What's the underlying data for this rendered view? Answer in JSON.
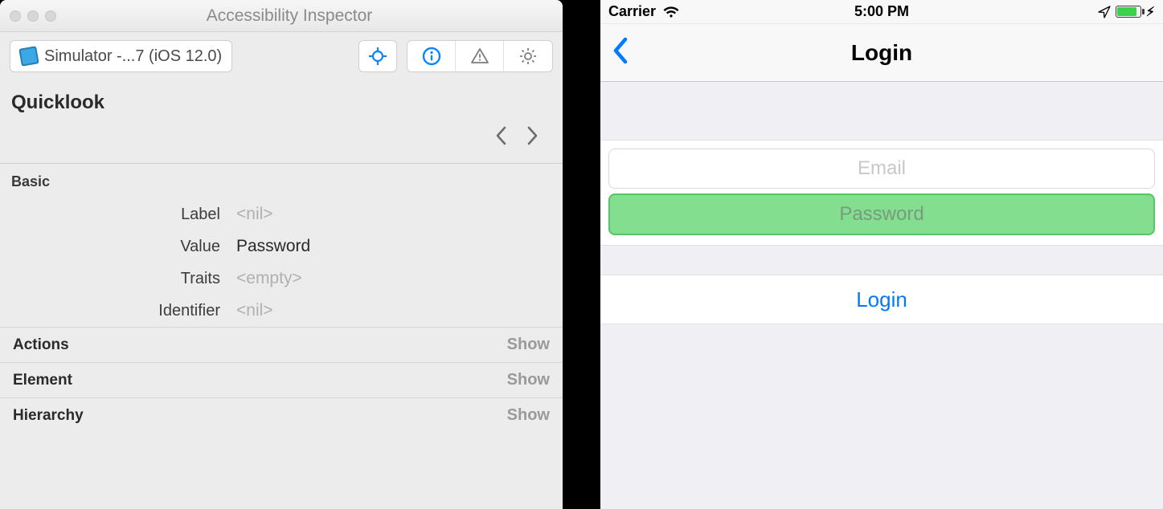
{
  "inspector": {
    "window_title": "Accessibility Inspector",
    "target": "Simulator -...7 (iOS 12.0)",
    "quicklook_title": "Quicklook",
    "basic": {
      "heading": "Basic",
      "label_key": "Label",
      "label_val": "<nil>",
      "value_key": "Value",
      "value_val": "Password",
      "traits_key": "Traits",
      "traits_val": "<empty>",
      "identifier_key": "Identifier",
      "identifier_val": "<nil>"
    },
    "rows": {
      "actions": "Actions",
      "element": "Element",
      "hierarchy": "Hierarchy",
      "show": "Show"
    }
  },
  "sim": {
    "carrier": "Carrier",
    "time": "5:00 PM",
    "nav_title": "Login",
    "email_placeholder": "Email",
    "password_placeholder": "Password",
    "login_button": "Login"
  }
}
